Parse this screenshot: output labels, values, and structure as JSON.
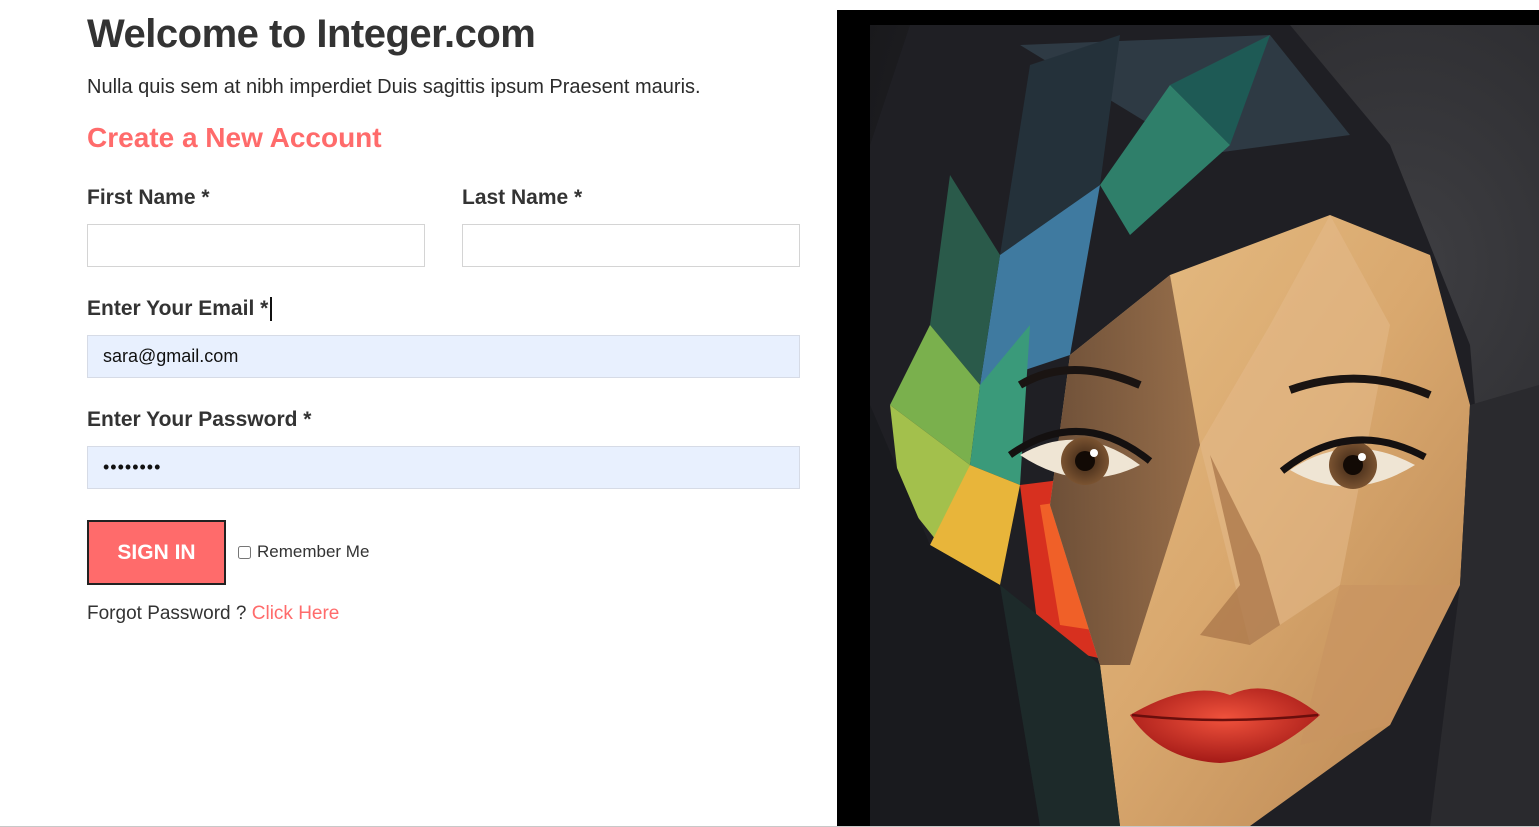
{
  "header": {
    "title": "Welcome to Integer.com",
    "subtitle": "Nulla quis sem at nibh imperdiet Duis sagittis ipsum Praesent mauris."
  },
  "form": {
    "heading": "Create a New Account",
    "first_name": {
      "label": "First Name *",
      "value": ""
    },
    "last_name": {
      "label": "Last Name *",
      "value": ""
    },
    "email": {
      "label": "Enter Your Email *",
      "value": "sara@gmail.com"
    },
    "password": {
      "label": "Enter Your Password *",
      "value": "••••••••"
    },
    "sign_in_label": "SIGN IN",
    "remember_label": "Remember Me",
    "remember_checked": false,
    "forgot_text": "Forgot Password ? ",
    "forgot_link": "Click Here"
  },
  "colors": {
    "accent": "#ff6b6b",
    "text": "#333333",
    "autofill": "#e8f0fe"
  },
  "artwork": {
    "subject": "cubist-portrait-painting"
  }
}
